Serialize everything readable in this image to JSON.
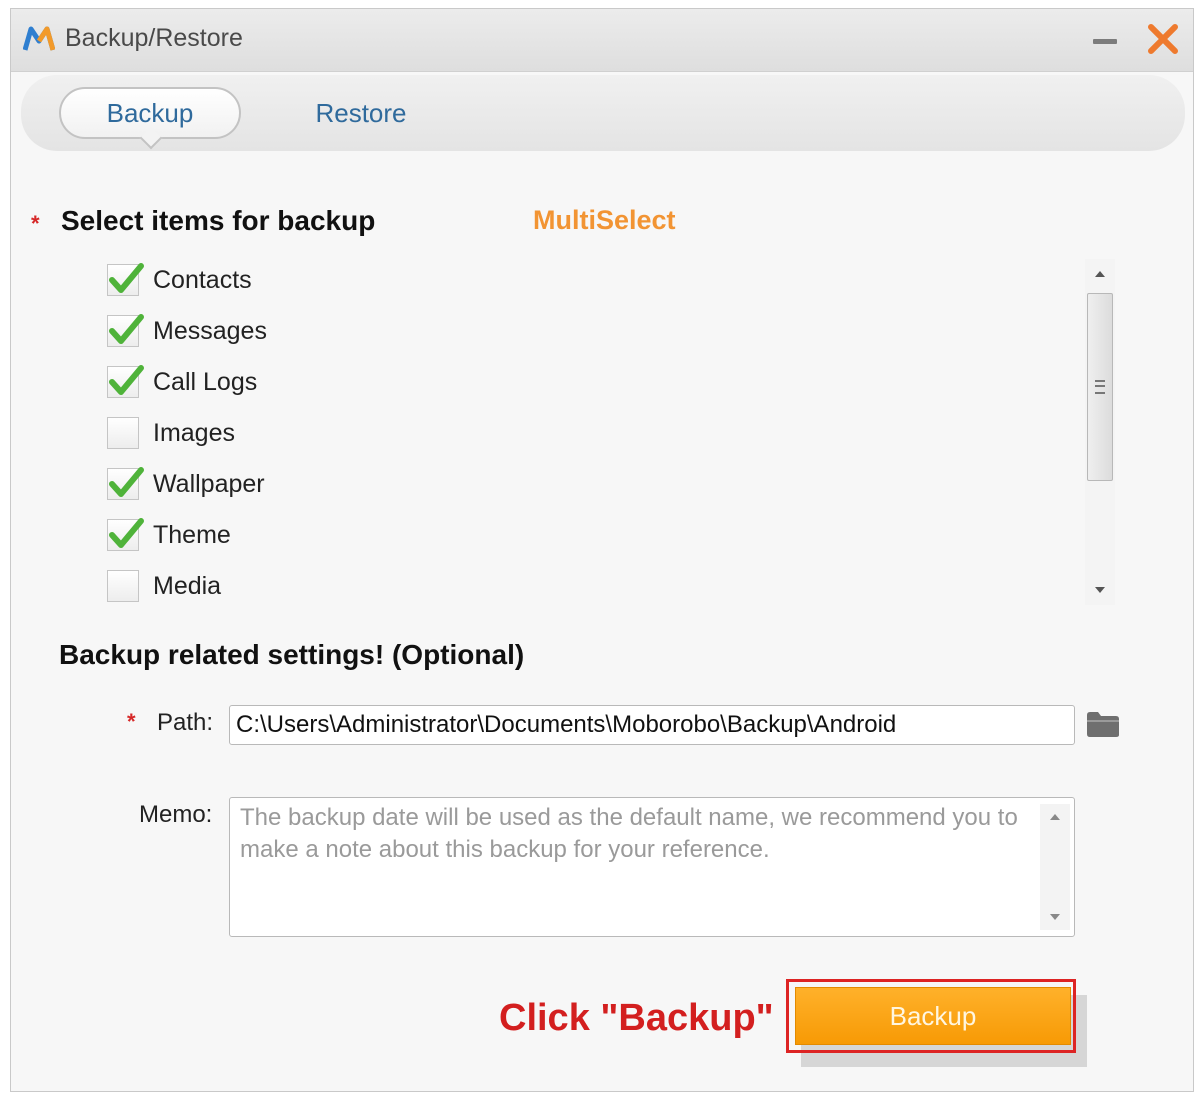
{
  "window": {
    "title": "Backup/Restore",
    "logo_icon": "mobogenie-m-logo-icon",
    "minimize_icon": "minimize-icon",
    "close_icon": "close-x-icon"
  },
  "tabs": [
    {
      "label": "Backup",
      "active": true
    },
    {
      "label": "Restore",
      "active": false
    }
  ],
  "select_section": {
    "required_marker": "*",
    "title": "Select items for backup",
    "multiselect_label": "MultiSelect",
    "items": [
      {
        "label": "Contacts",
        "checked": true
      },
      {
        "label": "Messages",
        "checked": true
      },
      {
        "label": "Call Logs",
        "checked": true
      },
      {
        "label": "Images",
        "checked": false
      },
      {
        "label": "Wallpaper",
        "checked": true
      },
      {
        "label": "Theme",
        "checked": true
      },
      {
        "label": "Media",
        "checked": false
      }
    ]
  },
  "settings_section": {
    "title": "Backup related settings! (Optional)",
    "path_required_marker": "*",
    "path_label": "Path:",
    "path_value": "C:\\Users\\Administrator\\Documents\\Moborobo\\Backup\\Android",
    "folder_icon": "folder-icon",
    "memo_label": "Memo:",
    "memo_placeholder": "The backup date will be used as the default name, we recommend you to make a note about this backup for your reference."
  },
  "action": {
    "annotation": "Click \"Backup\"",
    "backup_button_label": "Backup"
  },
  "colors": {
    "accent_orange": "#f29433",
    "backup_button": "#f79a05",
    "tab_text": "#2f6a9c",
    "annotation_red": "#d31f1f",
    "check_green": "#4fb33a"
  }
}
